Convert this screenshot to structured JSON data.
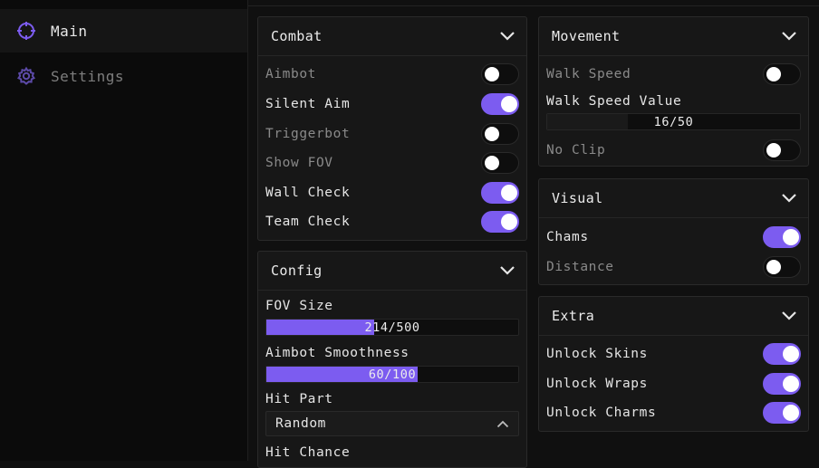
{
  "sidebar": {
    "items": [
      {
        "label": "Main",
        "icon": "crosshair-icon",
        "active": true
      },
      {
        "label": "Settings",
        "icon": "gear-icon",
        "active": false
      }
    ]
  },
  "accent": "#7c5cf0",
  "combat": {
    "title": "Combat",
    "toggles": [
      {
        "label": "Aimbot",
        "on": false
      },
      {
        "label": "Silent Aim",
        "on": true
      },
      {
        "label": "Triggerbot",
        "on": false
      },
      {
        "label": "Show FOV",
        "on": false
      },
      {
        "label": "Wall Check",
        "on": true
      },
      {
        "label": "Team Check",
        "on": true
      }
    ]
  },
  "config": {
    "title": "Config",
    "fov_size": {
      "label": "FOV Size",
      "value": 214,
      "max": 500,
      "text": "214/500"
    },
    "smoothness": {
      "label": "Aimbot Smoothness",
      "value": 60,
      "max": 100,
      "text": "60/100"
    },
    "hit_part": {
      "label": "Hit Part",
      "selected": "Random"
    },
    "hit_chance": {
      "label": "Hit Chance"
    }
  },
  "movement": {
    "title": "Movement",
    "walk_speed": {
      "label": "Walk Speed",
      "on": false
    },
    "walk_speed_value": {
      "label": "Walk Speed Value",
      "value": 16,
      "max": 50,
      "text": "16/50"
    },
    "no_clip": {
      "label": "No Clip",
      "on": false
    }
  },
  "visual": {
    "title": "Visual",
    "toggles": [
      {
        "label": "Chams",
        "on": true
      },
      {
        "label": "Distance",
        "on": false
      }
    ]
  },
  "extra": {
    "title": "Extra",
    "toggles": [
      {
        "label": "Unlock Skins",
        "on": true
      },
      {
        "label": "Unlock Wraps",
        "on": true
      },
      {
        "label": "Unlock Charms",
        "on": true
      }
    ]
  }
}
